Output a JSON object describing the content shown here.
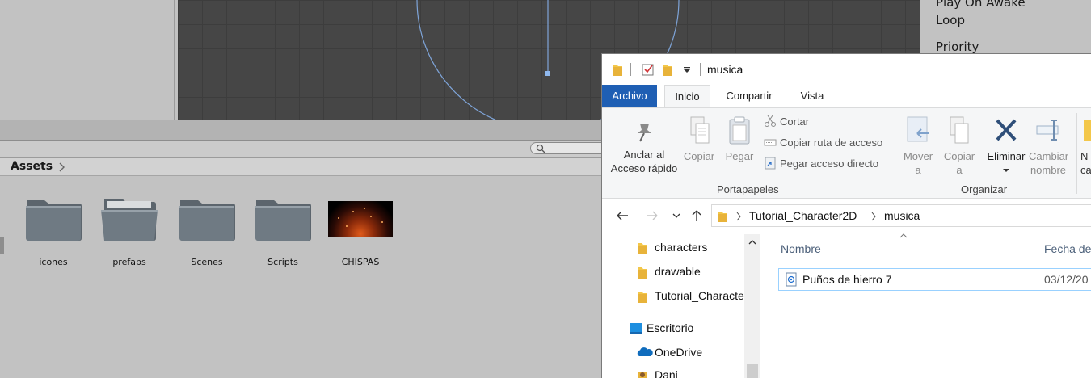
{
  "unity": {
    "inspector": {
      "rows": [
        "Play On Awake",
        "Loop",
        "Priority"
      ]
    },
    "project": {
      "breadcrumb": "Assets",
      "assets": [
        {
          "name": "icones",
          "kind": "folder-icon"
        },
        {
          "name": "prefabs",
          "kind": "folder-open-icon"
        },
        {
          "name": "Scenes",
          "kind": "folder-icon"
        },
        {
          "name": "Scripts",
          "kind": "folder-icon"
        },
        {
          "name": "CHISPAS",
          "kind": "texture-thumbnail"
        }
      ]
    }
  },
  "explorer": {
    "title": "musica",
    "tabs": [
      "Archivo",
      "Inicio",
      "Compartir",
      "Vista"
    ],
    "active_tab": "Inicio",
    "ribbon": {
      "pin_label_1": "Anclar al",
      "pin_label_2": "Acceso rápido",
      "copy": "Copiar",
      "paste": "Pegar",
      "cut": "Cortar",
      "copy_path": "Copiar ruta de acceso",
      "paste_shortcut": "Pegar acceso directo",
      "clipboard_group": "Portapapeles",
      "move_1": "Mover",
      "move_2": "a",
      "copyto_1": "Copiar",
      "copyto_2": "a",
      "delete": "Eliminar",
      "rename_1": "Cambiar",
      "rename_2": "nombre",
      "organize_group": "Organizar",
      "new_1": "N",
      "new_2": "ca"
    },
    "address": [
      "Tutorial_Character2D",
      "musica"
    ],
    "nav_pane": [
      "characters",
      "drawable",
      "Tutorial_Characte",
      "Escritorio",
      "OneDrive",
      "Dani"
    ],
    "columns": {
      "name": "Nombre",
      "date": "Fecha de"
    },
    "files": [
      {
        "name": "Puños de hierro 7",
        "date": "03/12/20"
      }
    ],
    "colors": {
      "file_tab": "#1f5fb4",
      "selection_border": "#99d1ff",
      "folder": "#f3c74a"
    }
  }
}
